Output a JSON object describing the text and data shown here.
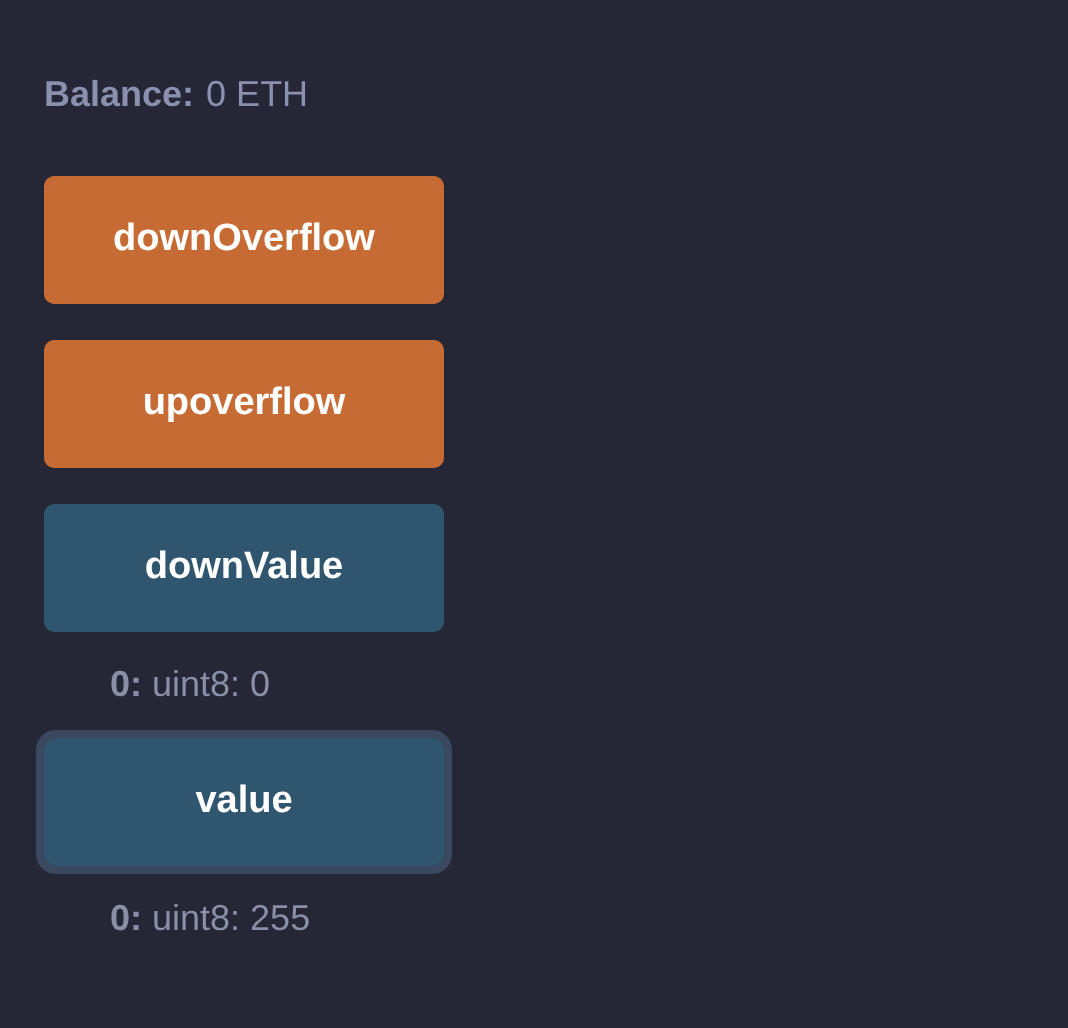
{
  "balance": {
    "label": "Balance:",
    "value": "0 ETH"
  },
  "functions": [
    {
      "label": "downOverflow",
      "kind": "transact",
      "focused": false
    },
    {
      "label": "upoverflow",
      "kind": "transact",
      "focused": false
    },
    {
      "label": "downValue",
      "kind": "call",
      "focused": false,
      "output": "**0:** uint8: 0"
    },
    {
      "label": "value",
      "kind": "call",
      "focused": true,
      "output": "**0:** uint8: 255"
    }
  ]
}
